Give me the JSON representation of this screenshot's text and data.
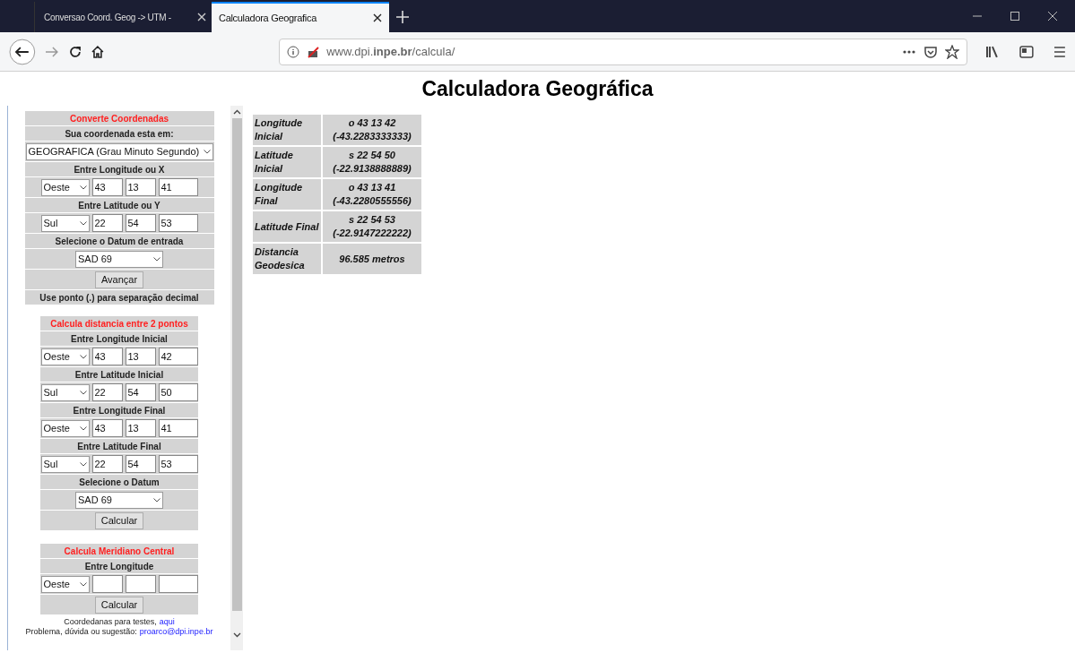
{
  "tabs": [
    {
      "label": "Conversao Coord. Geog -> UTM -",
      "selected": false
    },
    {
      "label": "Calculadora Geografica",
      "selected": true
    }
  ],
  "url": "www.dpi.**inpe.br**/calcula/",
  "page_title": "Calculadora Geográfica",
  "converter": {
    "heading": "Converte Coordenadas",
    "question": "Sua coordenada esta em:",
    "format": "GEOGRAFICA (Grau Minuto Segundo)",
    "groups": [
      {
        "label": "Entre Longitude ou X",
        "hemisphere": "Oeste",
        "deg": "43",
        "min": "13",
        "sec": "41"
      },
      {
        "label": "Entre Latitude ou Y",
        "hemisphere": "Sul",
        "deg": "22",
        "min": "54",
        "sec": "53"
      }
    ],
    "datum_label": "Selecione o Datum de entrada",
    "datum": "SAD 69",
    "button": "Avançar",
    "note": "Use ponto (.) para separação decimal"
  },
  "distance": {
    "heading": "Calcula distancia entre 2 pontos",
    "groups": [
      {
        "label": "Entre Longitude Inicial",
        "hemisphere": "Oeste",
        "deg": "43",
        "min": "13",
        "sec": "42"
      },
      {
        "label": "Entre Latitude Inicial",
        "hemisphere": "Sul",
        "deg": "22",
        "min": "54",
        "sec": "50"
      },
      {
        "label": "Entre Longitude Final",
        "hemisphere": "Oeste",
        "deg": "43",
        "min": "13",
        "sec": "41"
      },
      {
        "label": "Entre Latitude Final",
        "hemisphere": "Sul",
        "deg": "22",
        "min": "54",
        "sec": "53"
      }
    ],
    "datum_label": "Selecione o Datum",
    "datum": "SAD 69",
    "button": "Calcular"
  },
  "meridian": {
    "heading": "Calcula Meridiano Central",
    "groups": [
      {
        "label": "Entre Longitude",
        "hemisphere": "Oeste"
      }
    ],
    "button": "Calcular"
  },
  "footer": [
    {
      "text": "Coordedanas para testes,",
      "link": "aqui"
    },
    {
      "text": "Problema, dúvida ou sugestão:",
      "link": "proarco@dpi.inpe.br"
    }
  ],
  "results": [
    {
      "label": "Longitude Inicial",
      "value": "o 43 13 42",
      "decimal": "(-43.2283333333)"
    },
    {
      "label": "Latitude Inicial",
      "value": "s 22 54 50",
      "decimal": "(-22.9138888889)"
    },
    {
      "label": "Longitude Final",
      "value": "o 43 13 41",
      "decimal": "(-43.2280555556)"
    },
    {
      "label": "Latitude Final",
      "value": "s 22 54 53",
      "decimal": "(-22.9147222222)"
    },
    {
      "label": "Distancia Geodesica",
      "value": "96.585 metros"
    }
  ]
}
